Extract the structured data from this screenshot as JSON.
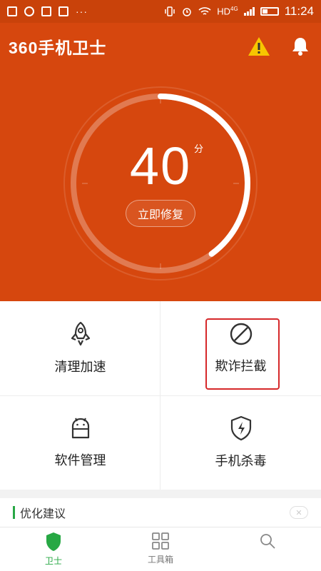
{
  "status_bar": {
    "network": "HD",
    "network_gen": "4G",
    "time": "11:24",
    "more": "···"
  },
  "header": {
    "app_title": "360手机卫士",
    "warning_icon": "warning-icon",
    "bell_icon": "bell-icon"
  },
  "score": {
    "value": "40",
    "unit": "分",
    "action_label": "立即修复"
  },
  "features": [
    {
      "label": "清理加速",
      "icon": "rocket-icon"
    },
    {
      "label": "欺诈拦截",
      "icon": "block-icon"
    },
    {
      "label": "软件管理",
      "icon": "android-icon"
    },
    {
      "label": "手机杀毒",
      "icon": "shield-bolt-icon"
    }
  ],
  "suggestion": {
    "title": "优化建议"
  },
  "tabs": [
    {
      "label": "卫士",
      "icon": "shield-icon",
      "active": true
    },
    {
      "label": "工具箱",
      "icon": "grid-icon",
      "active": false
    },
    {
      "label": "",
      "icon": "search-icon",
      "active": false
    }
  ],
  "colors": {
    "brand_orange": "#d6470e",
    "accent_green": "#27a844",
    "highlight_red": "#d6282a"
  }
}
